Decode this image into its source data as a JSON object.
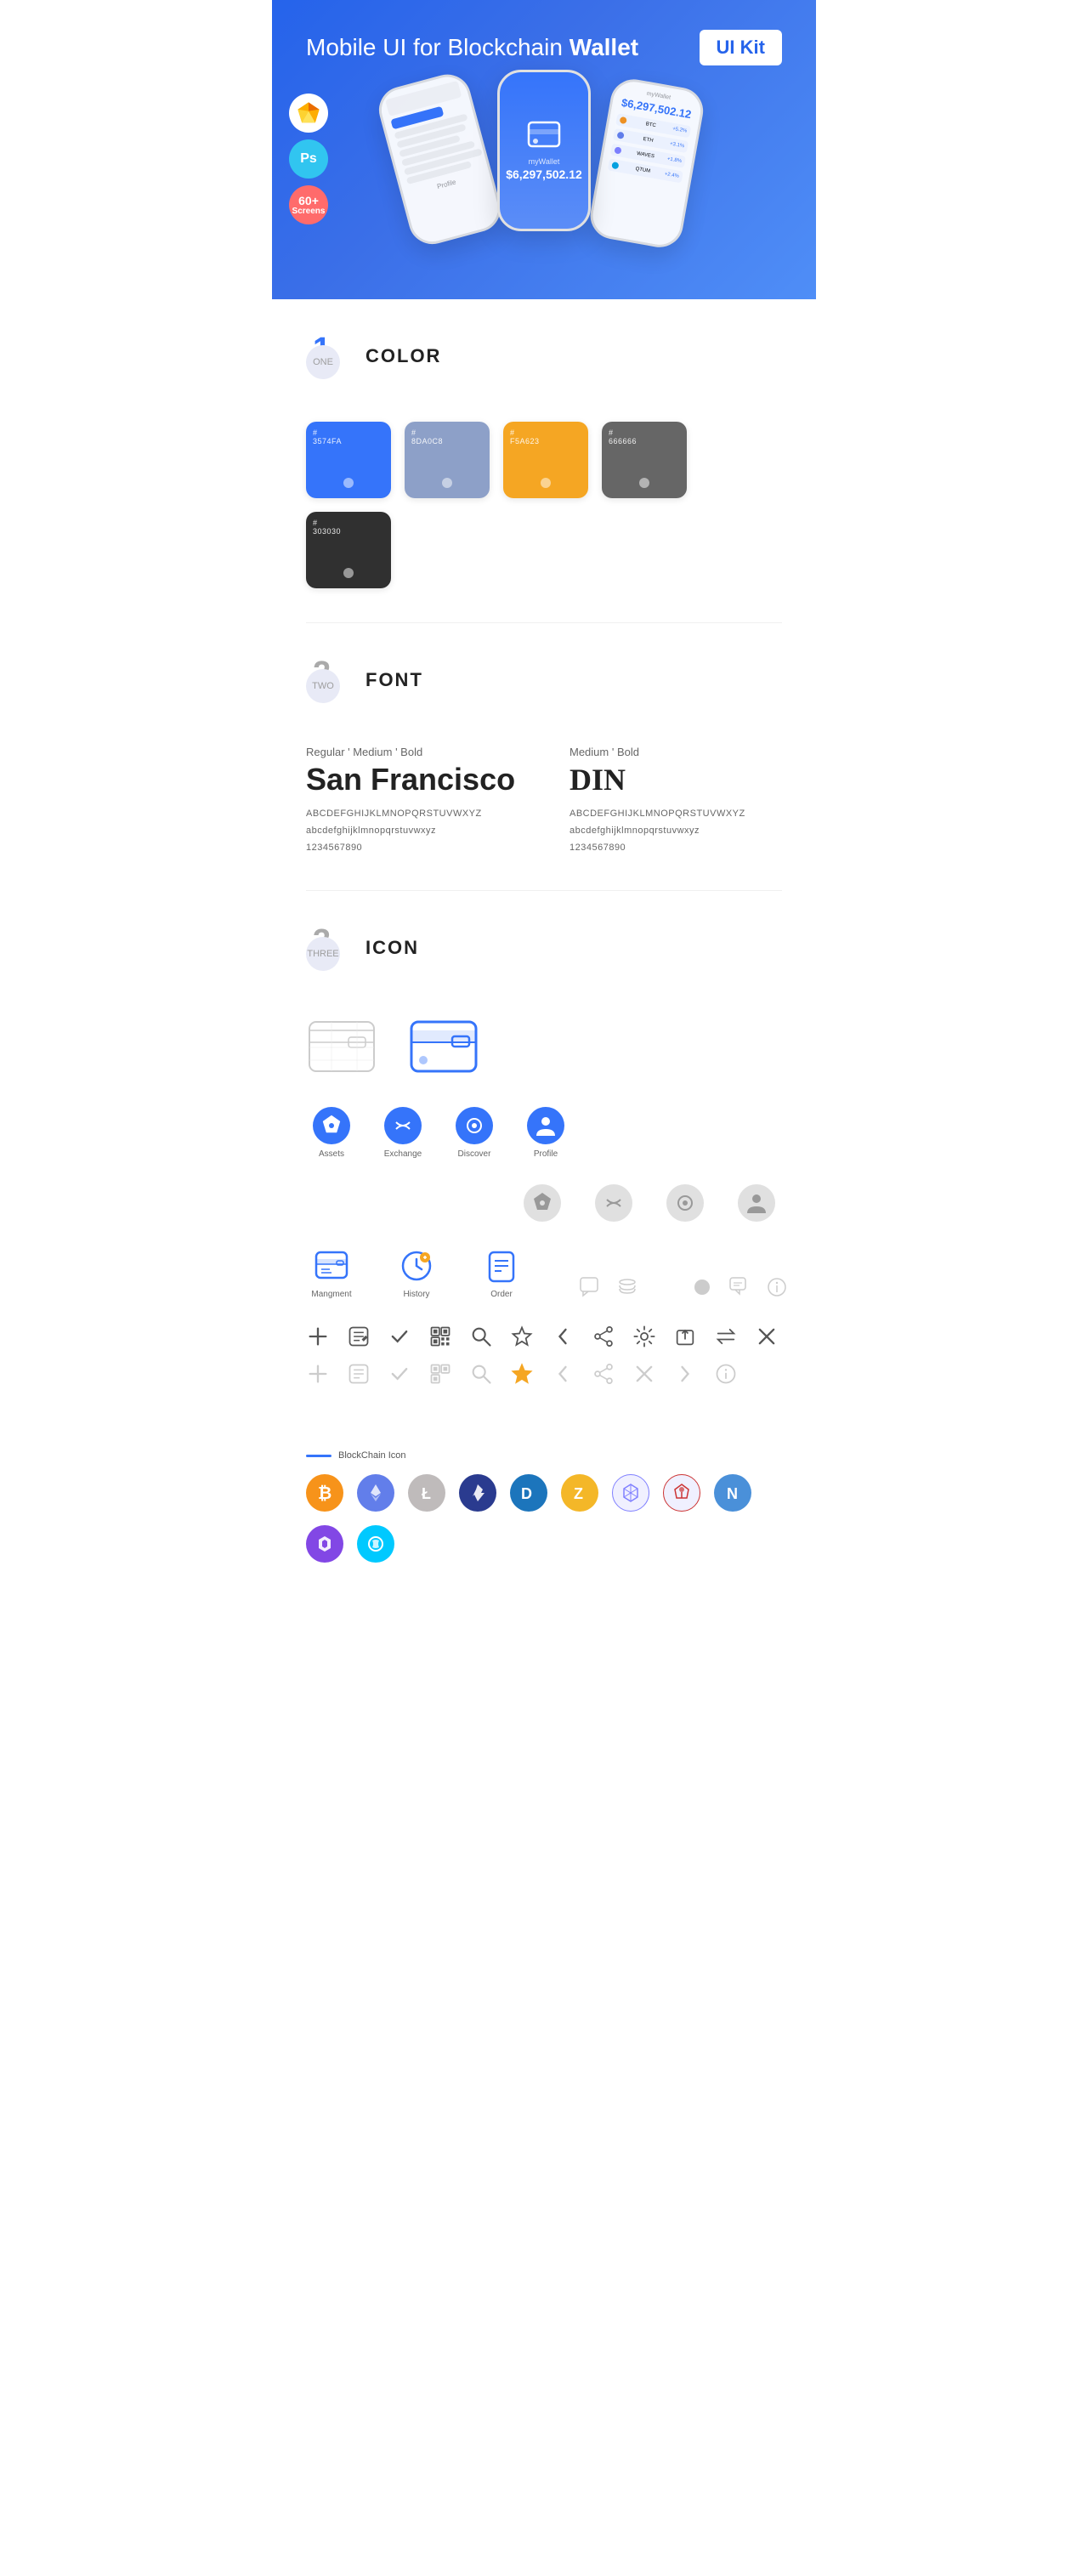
{
  "hero": {
    "title": "Mobile UI for Blockchain ",
    "titleBold": "Wallet",
    "uiKitBadge": "UI Kit",
    "badges": [
      {
        "type": "sketch",
        "label": "Sketch"
      },
      {
        "type": "ps",
        "label": "Ps"
      },
      {
        "type": "screens",
        "num": "60+",
        "sub": "Screens"
      }
    ]
  },
  "sections": [
    {
      "number": "1",
      "sub": "ONE",
      "title": "COLOR"
    },
    {
      "number": "2",
      "sub": "TWO",
      "title": "FONT"
    },
    {
      "number": "3",
      "sub": "THREE",
      "title": "ICON"
    }
  ],
  "colors": [
    {
      "hex": "#3574FA",
      "code": "#\n3574FA",
      "name": ""
    },
    {
      "hex": "#8DA0C8",
      "code": "#\n8DA0C8",
      "name": ""
    },
    {
      "hex": "#F5A623",
      "code": "#\nF5A623",
      "name": ""
    },
    {
      "hex": "#666666",
      "code": "#\n666666",
      "name": ""
    },
    {
      "hex": "#303030",
      "code": "#\n303030",
      "name": ""
    }
  ],
  "fonts": [
    {
      "styles": "Regular ' Medium ' Bold",
      "name": "San Francisco",
      "chars_upper": "ABCDEFGHIJKLMNOPQRSTUVWXYZ",
      "chars_lower": "abcdefghijklmnopqrstuvwxyz",
      "chars_num": "1234567890"
    },
    {
      "styles": "Medium ' Bold",
      "name": "DIN",
      "chars_upper": "ABCDEFGHIJKLMNOPQRSTUVWXYZ",
      "chars_lower": "abcdefghijklmnopqrstuvwxyz",
      "chars_num": "1234567890"
    }
  ],
  "icons": {
    "main_labeled": [
      {
        "name": "Assets",
        "type": "diamond"
      },
      {
        "name": "Exchange",
        "type": "exchange"
      },
      {
        "name": "Discover",
        "type": "discover"
      },
      {
        "name": "Profile",
        "type": "profile"
      }
    ],
    "main_labeled_gray": [
      {
        "name": "",
        "type": "diamond-gray"
      },
      {
        "name": "",
        "type": "exchange-gray"
      },
      {
        "name": "",
        "type": "discover-gray"
      },
      {
        "name": "",
        "type": "profile-gray"
      }
    ],
    "bottom_nav": [
      {
        "name": "Mangment",
        "type": "management"
      },
      {
        "name": "History",
        "type": "history"
      },
      {
        "name": "Order",
        "type": "order"
      }
    ],
    "toolbar": [
      {
        "type": "plus"
      },
      {
        "type": "edit-list"
      },
      {
        "type": "check"
      },
      {
        "type": "qr"
      },
      {
        "type": "search"
      },
      {
        "type": "star"
      },
      {
        "type": "back"
      },
      {
        "type": "share"
      },
      {
        "type": "gear"
      },
      {
        "type": "upload"
      },
      {
        "type": "swap"
      },
      {
        "type": "close"
      }
    ],
    "toolbar_gray": [
      {
        "type": "plus"
      },
      {
        "type": "edit-list"
      },
      {
        "type": "check"
      },
      {
        "type": "qr"
      },
      {
        "type": "search"
      },
      {
        "type": "star-outline"
      },
      {
        "type": "back"
      },
      {
        "type": "share"
      },
      {
        "type": "x"
      },
      {
        "type": "forward"
      },
      {
        "type": "info"
      }
    ]
  },
  "blockchain": {
    "label": "BlockChain Icon",
    "coins": [
      {
        "name": "Bitcoin",
        "color": "#F7931A",
        "symbol": "₿"
      },
      {
        "name": "Ethereum",
        "color": "#627EEA",
        "symbol": "Ξ"
      },
      {
        "name": "Litecoin",
        "color": "#BFBBBB",
        "symbol": "Ł"
      },
      {
        "name": "Feathercoin",
        "color": "#2A3B8F",
        "symbol": "✦"
      },
      {
        "name": "Dash",
        "color": "#1C75BC",
        "symbol": "D"
      },
      {
        "name": "Zcash",
        "color": "#F4B728",
        "symbol": "Z"
      },
      {
        "name": "Hashgraph",
        "color": "#8080ff",
        "symbol": "⬡"
      },
      {
        "name": "Ark",
        "color": "#F70000",
        "symbol": "A"
      },
      {
        "name": "Nano",
        "color": "#4A90D9",
        "symbol": "N"
      },
      {
        "name": "Polygon",
        "color": "#8247E5",
        "symbol": "P"
      },
      {
        "name": "Skycoin",
        "color": "#00C9FF",
        "symbol": "S"
      }
    ]
  }
}
